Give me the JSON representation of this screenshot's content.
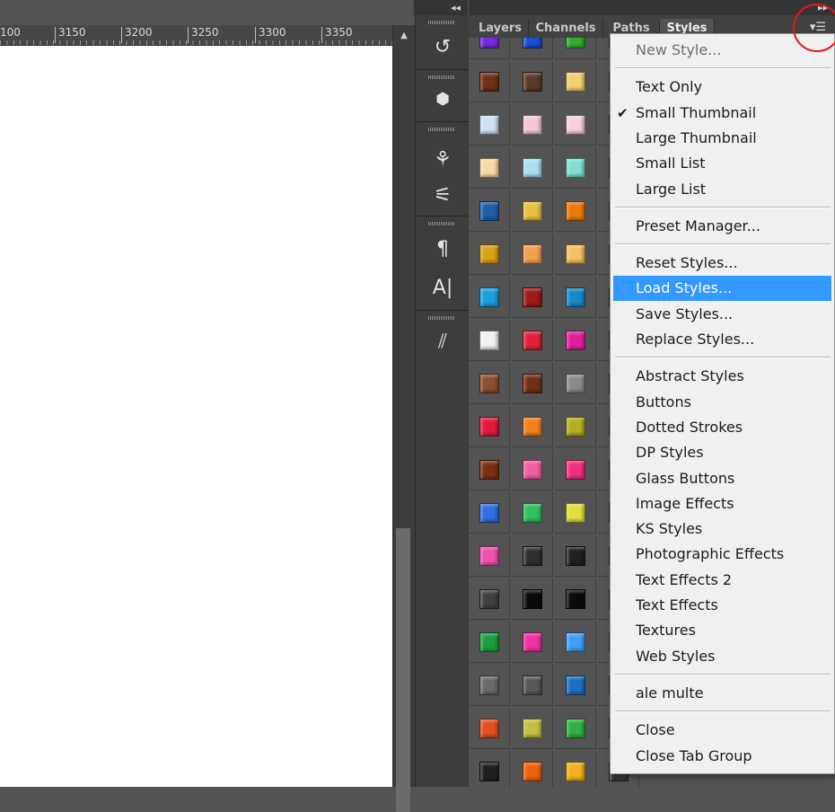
{
  "ruler": {
    "marks": [
      "100",
      "3150",
      "3200",
      "3250",
      "3300",
      "3350"
    ]
  },
  "scrollbar": {
    "up_arrow": "▲"
  },
  "dock": {
    "collapse_label": "◂◂",
    "tools": [
      {
        "icon": "history-icon",
        "glyph": "↺"
      },
      {
        "icon": "3d-cube-icon",
        "glyph": "⬢"
      },
      {
        "icon": "brush-presets-icon",
        "glyph": "⚘"
      },
      {
        "icon": "adjustments-sliders-icon",
        "glyph": "⚟"
      },
      {
        "icon": "paragraph-icon",
        "glyph": "¶"
      },
      {
        "icon": "character-icon",
        "glyph": "A|"
      },
      {
        "icon": "lines-icon",
        "glyph": "⫽"
      }
    ]
  },
  "panel": {
    "collapse_label": "▸▸",
    "tabs": [
      {
        "label": "Layers",
        "active": false
      },
      {
        "label": "Channels",
        "active": false
      },
      {
        "label": "Paths",
        "active": false
      },
      {
        "label": "Styles",
        "active": true
      }
    ],
    "menu_button_glyph": "▾☰",
    "highlight_color": "#e11a1a"
  },
  "styles_grid": {
    "columns": 4,
    "rows": [
      [
        "#7a2be0",
        "#1a4fd6",
        "#2fb02f",
        "#404040"
      ],
      [
        "#6e3216",
        "#5a3a2a",
        "#f0d070",
        "#404040"
      ],
      [
        "#cfe0f2",
        "#f2c8d8",
        "#f5d0dc",
        "#404040"
      ],
      [
        "#f7d8a6",
        "#a8e0f0",
        "#7fe0d0",
        "#404040"
      ],
      [
        "#1f5fa8",
        "#e8c040",
        "#e87a10",
        "#404040"
      ],
      [
        "#d9a018",
        "#f0a050",
        "#f5c060",
        "#404040"
      ],
      [
        "#1aa0e0",
        "#a01818",
        "#1a88c8",
        "#404040"
      ],
      [
        "#f2f2f2",
        "#e0203a",
        "#e0209a",
        "#404040"
      ],
      [
        "#8a5030",
        "#703018",
        "#8a8a8a",
        "#404040"
      ],
      [
        "#e01a3a",
        "#f08020",
        "#b0b020",
        "#404040"
      ],
      [
        "#7a3010",
        "#f060a0",
        "#f03080",
        "#404040"
      ],
      [
        "#3070e0",
        "#30c060",
        "#e0e040",
        "#404040"
      ],
      [
        "#f050b0",
        "#303030",
        "#202020",
        "#404040"
      ],
      [
        "#404040",
        "#0a0a0a",
        "#0a0a0a",
        "#404040"
      ],
      [
        "#1aa040",
        "#f030a0",
        "#40a0f0",
        "#404040"
      ],
      [
        "#6a6a6a",
        "#585858",
        "#1a70c0",
        "#404040"
      ],
      [
        "#e05020",
        "#c0c040",
        "#30b040",
        "#404040"
      ],
      [
        "#202020",
        "#f06010",
        "#f0b020",
        "#404040"
      ]
    ]
  },
  "menu": {
    "items": [
      {
        "label": "New Style...",
        "disabled": true
      },
      {
        "sep": true
      },
      {
        "label": "Text Only"
      },
      {
        "label": "Small Thumbnail",
        "checked": true
      },
      {
        "label": "Large Thumbnail"
      },
      {
        "label": "Small List"
      },
      {
        "label": "Large List"
      },
      {
        "sep": true
      },
      {
        "label": "Preset Manager..."
      },
      {
        "sep": true
      },
      {
        "label": "Reset Styles..."
      },
      {
        "label": "Load Styles...",
        "selected": true
      },
      {
        "label": "Save Styles..."
      },
      {
        "label": "Replace Styles..."
      },
      {
        "sep": true
      },
      {
        "label": "Abstract Styles"
      },
      {
        "label": "Buttons"
      },
      {
        "label": "Dotted Strokes"
      },
      {
        "label": "DP Styles"
      },
      {
        "label": "Glass Buttons"
      },
      {
        "label": "Image Effects"
      },
      {
        "label": "KS Styles"
      },
      {
        "label": "Photographic Effects"
      },
      {
        "label": "Text Effects 2"
      },
      {
        "label": "Text Effects"
      },
      {
        "label": "Textures"
      },
      {
        "label": "Web Styles"
      },
      {
        "sep": true
      },
      {
        "label": "ale multe"
      },
      {
        "sep": true
      },
      {
        "label": "Close"
      },
      {
        "label": "Close Tab Group"
      }
    ],
    "check_glyph": "✔",
    "selected_color": "#3399ff"
  }
}
